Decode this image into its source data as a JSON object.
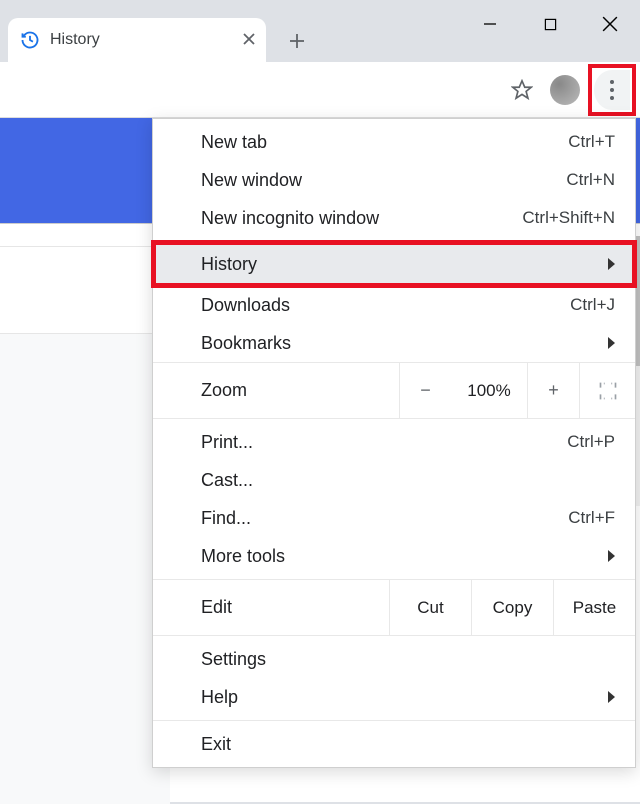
{
  "tab": {
    "title": "History"
  },
  "menu": {
    "group1": [
      {
        "label": "New tab",
        "shortcut": "Ctrl+T"
      },
      {
        "label": "New window",
        "shortcut": "Ctrl+N"
      },
      {
        "label": "New incognito window",
        "shortcut": "Ctrl+Shift+N"
      }
    ],
    "group2": {
      "history": "History",
      "downloads": {
        "label": "Downloads",
        "shortcut": "Ctrl+J"
      },
      "bookmarks": "Bookmarks"
    },
    "zoom": {
      "label": "Zoom",
      "minus": "−",
      "pct": "100%",
      "plus": "+"
    },
    "group4": {
      "print": {
        "label": "Print...",
        "shortcut": "Ctrl+P"
      },
      "cast": "Cast...",
      "find": {
        "label": "Find...",
        "shortcut": "Ctrl+F"
      },
      "moretools": "More tools"
    },
    "edit": {
      "label": "Edit",
      "cut": "Cut",
      "copy": "Copy",
      "paste": "Paste"
    },
    "group6": {
      "settings": "Settings",
      "help": "Help"
    },
    "exit": "Exit"
  }
}
